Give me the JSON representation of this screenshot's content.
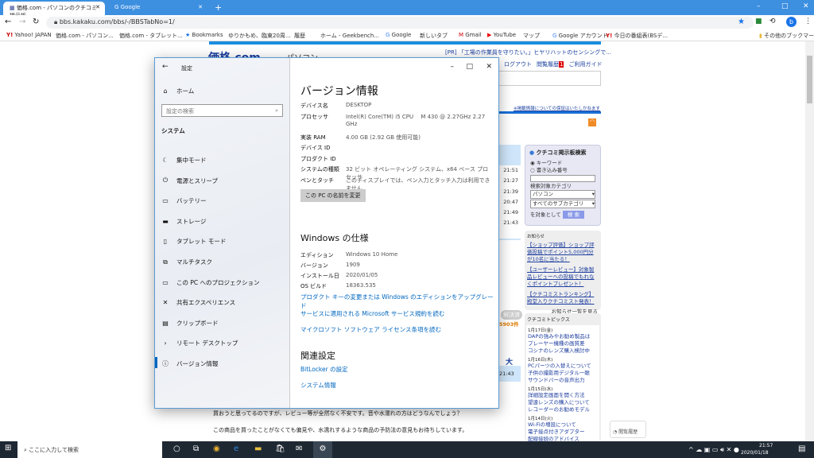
{
  "browser": {
    "tabs": [
      {
        "label": "価格.com - パソコンのクチコミ掲示板",
        "active": true
      },
      {
        "label": "Google",
        "active": false
      }
    ],
    "new_tab": "+",
    "window_controls": [
      "–",
      "□",
      "✕"
    ],
    "url": "bbs.kakaku.com/bbs/-/BBSTabNo=1/",
    "profile_initial": "b",
    "bookmarks": [
      "Yahoo! JAPAN",
      "価格.com - パソコン...",
      "価格.com - タブレット...",
      "Bookmarks",
      "ゆりかもめ、臨東20周...",
      "履歴",
      "ホーム - Geekbench...",
      "Google",
      "新しいタブ",
      "Gmail",
      "YouTube",
      "マップ",
      "Google アカウント",
      "今日の番組表(BSデ..."
    ],
    "other_bookmarks": "その他のブックマーク"
  },
  "webpage": {
    "logo": "価格.com",
    "category": "パソコン",
    "pr_text": "[PR] 「工場の作業員を守りたい。」ヒヤリハットのセンシングで...",
    "header_links": [
      "ログアウト",
      "閲覧履歴",
      "ご利用ガイド"
    ],
    "history_badge": "1",
    "notice": "※掲載情報についての保証はいたしかねます",
    "times": [
      "21:51",
      "21:27",
      "21:39",
      "20:47",
      "21:49",
      "21:43"
    ],
    "search_box": {
      "title": "クチコミ掲示板検索",
      "radio_keyword": "キーワード",
      "radio_number": "書き込み番号",
      "category_label": "検索対象カテゴリ",
      "category": "パソコン",
      "subcategory": "すべてのサブカテゴリ",
      "target_label": "を対象として",
      "search_button": "検 索"
    },
    "news": {
      "title": "お知らせ",
      "items": [
        "【ショップ評価】ショップ評価投稿でポイント5,000円分が10名に当たる！",
        "【ユーザーレビュー】対象製品レビューへの投稿でもれなくポイントプレゼント！",
        "【クチコミストランキング】殿堂入りクチコミスト発表！"
      ],
      "more": "お知らせ一覧を見る"
    },
    "topics": {
      "title": "クチコミトピックス",
      "days": [
        {
          "date": "1月17日(金)",
          "items": [
            "DAPの強みやお勧め製品は",
            "プレーヤー機種の画質差",
            "コシナのレンズ購入検討中"
          ]
        },
        {
          "date": "1月16日(木)",
          "items": [
            "PCパーツの入替えについて",
            "子供の撮影用デジタル一眼",
            "サウンドバーの音声出力"
          ]
        },
        {
          "date": "1月15日(水)",
          "items": [
            "詳細設定画面を開く方法",
            "望遠レンズの購入について",
            "レコーダーのお勧めモデル"
          ]
        },
        {
          "date": "1月14日(火)",
          "items": [
            "Wi-Fiの増設について",
            "電子接点付きアダプター",
            "配線接続のアドバイス"
          ]
        }
      ]
    },
    "resolved": "解決済",
    "count": "5903件",
    "font_large": "大",
    "post_time": "21:43",
    "body_lines": [
      "買おうと思ってるのですが、レビュー等が全然なく不安です。音や水濡れの方はどうなんでしょう？",
      "この商品を買ったことがなくても偏見や、水濡れするような商品の予防法の意見もお待ちしています。"
    ],
    "history_button": "閲覧履歴"
  },
  "settings": {
    "title": "設定",
    "home": "ホーム",
    "search_placeholder": "設定の検索",
    "section": "システム",
    "nav": [
      {
        "label": "集中モード",
        "icon": "moon-icon"
      },
      {
        "label": "電源とスリープ",
        "icon": "power-icon"
      },
      {
        "label": "バッテリー",
        "icon": "battery-icon"
      },
      {
        "label": "ストレージ",
        "icon": "storage-icon"
      },
      {
        "label": "タブレット モード",
        "icon": "tablet-icon"
      },
      {
        "label": "マルチタスク",
        "icon": "multitask-icon"
      },
      {
        "label": "この PC へのプロジェクション",
        "icon": "projection-icon"
      },
      {
        "label": "共有エクスペリエンス",
        "icon": "share-icon"
      },
      {
        "label": "クリップボード",
        "icon": "clipboard-icon"
      },
      {
        "label": "リモート デスクトップ",
        "icon": "remote-icon"
      },
      {
        "label": "バージョン情報",
        "icon": "info-icon",
        "selected": true
      }
    ],
    "about": {
      "title": "バージョン情報",
      "specs": [
        {
          "k": "デバイス名",
          "v": "DESKTOP"
        },
        {
          "k": "プロセッサ",
          "v": "Intel(R) Core(TM) i5 CPU　 M 430 @ 2.27GHz 2.27 GHz"
        },
        {
          "k": "実装 RAM",
          "v": "4.00 GB (2.92 GB 使用可能)"
        },
        {
          "k": "デバイス ID",
          "v": ""
        },
        {
          "k": "プロダクト ID",
          "v": ""
        },
        {
          "k": "システムの種類",
          "v": "32 ビット オペレーティング システム、x64 ベース プロセッサ"
        },
        {
          "k": "ペンとタッチ",
          "v": "このディスプレイでは、ペン入力とタッチ入力は利用できません"
        }
      ],
      "rename_button": "この PC の名前を変更",
      "win_title": "Windows の仕様",
      "win_specs": [
        {
          "k": "エディション",
          "v": "Windows 10 Home"
        },
        {
          "k": "バージョン",
          "v": "1909"
        },
        {
          "k": "インストール日",
          "v": "2020/01/05"
        },
        {
          "k": "OS ビルド",
          "v": "18363.535"
        }
      ],
      "links": [
        "プロダクト キーの変更または Windows のエディションをアップグレード",
        "サービスに適用される Microsoft サービス規約を読む",
        "マイクロソフト ソフトウェア ライセンス条項を読む"
      ],
      "related_title": "関連設定",
      "related": [
        "BitLocker の設定",
        "システム情報"
      ]
    }
  },
  "taskbar": {
    "search_placeholder": "ここに入力して検索",
    "time": "21:57",
    "date": "2020/01/18"
  },
  "colors": {
    "chrome_blue": "#3d8fe0",
    "link": "#0067c0",
    "taskbar": "#1e2833",
    "kakaku_blue": "#1a6fd6"
  }
}
